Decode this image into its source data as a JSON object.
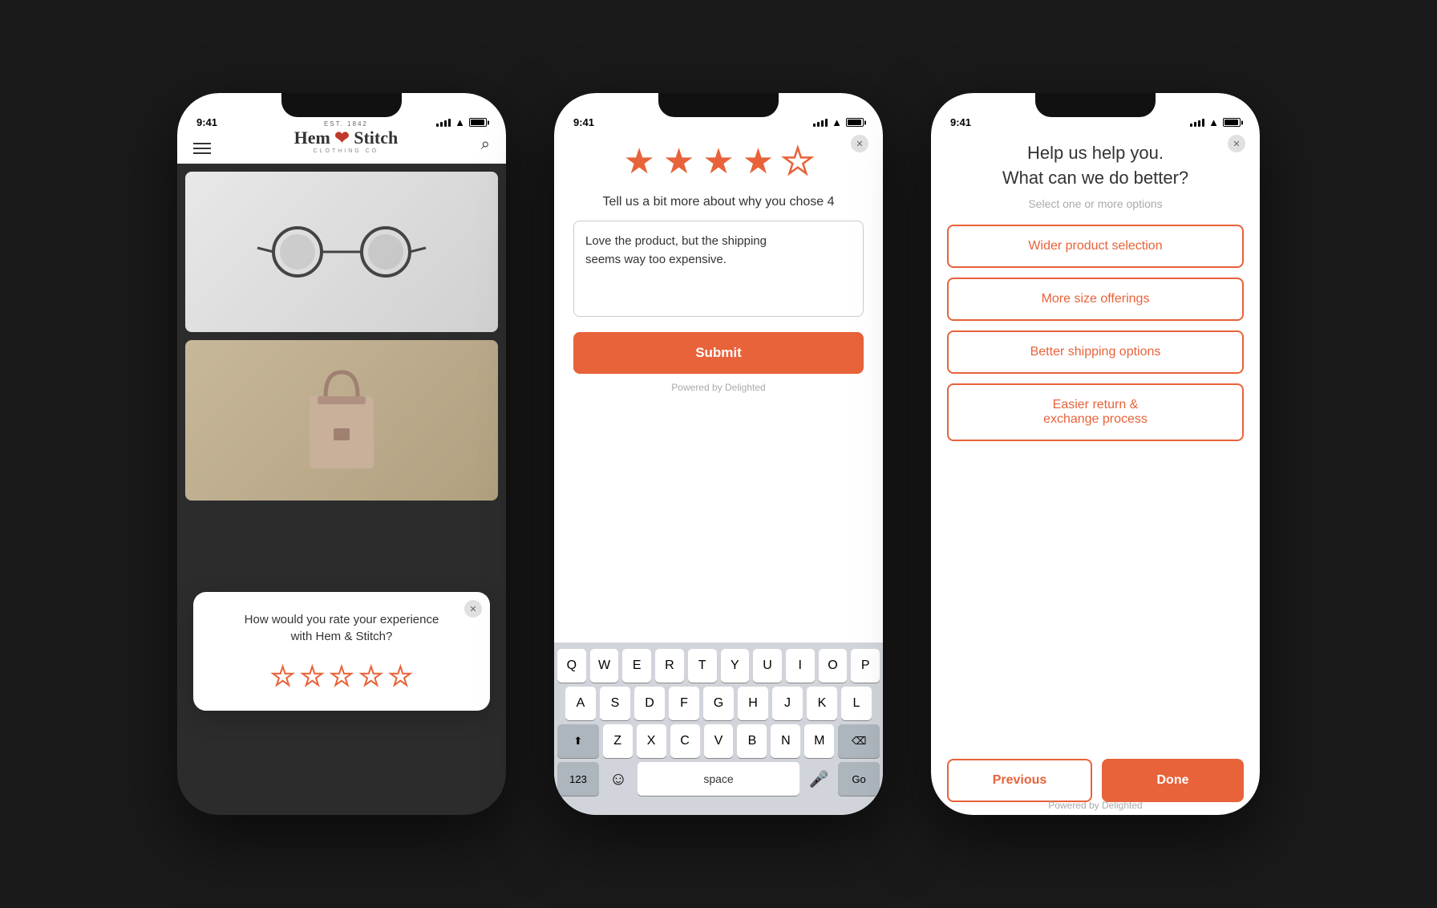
{
  "phone1": {
    "status_time": "9:41",
    "brand_est": "EST. 1842",
    "brand_name": "Hem",
    "brand_circle": "⊕",
    "brand_name2": "Stitch",
    "brand_sub": "CLOTHING CO",
    "modal": {
      "question_line1": "How would you rate your experience",
      "question_line2": "with Hem & Stitch?",
      "close_label": "✕",
      "stars": [
        0,
        0,
        0,
        0,
        0
      ]
    }
  },
  "phone2": {
    "status_time": "9:41",
    "close_label": "✕",
    "stars": [
      1,
      1,
      1,
      1,
      0
    ],
    "review_question": "Tell us a bit more about why you chose 4",
    "textarea_value": "Love the product, but the shipping\nseems way too expensive.",
    "submit_label": "Submit",
    "powered_label": "Powered by Delighted",
    "keyboard": {
      "row1": [
        "Q",
        "W",
        "E",
        "R",
        "T",
        "Y",
        "U",
        "I",
        "O",
        "P"
      ],
      "row2": [
        "A",
        "S",
        "D",
        "F",
        "G",
        "H",
        "J",
        "K",
        "L"
      ],
      "row3": [
        "Z",
        "X",
        "C",
        "V",
        "B",
        "N",
        "M"
      ],
      "num_label": "123",
      "space_label": "space",
      "go_label": "Go"
    }
  },
  "phone3": {
    "status_time": "9:41",
    "close_label": "✕",
    "title_line1": "Help us help you.",
    "title_line2": "What can we do better?",
    "subtitle": "Select one or more options",
    "options": [
      "Wider product selection",
      "More size offerings",
      "Better shipping options",
      "Easier return &\nexchange process"
    ],
    "prev_label": "Previous",
    "done_label": "Done",
    "powered_label": "Powered by Delighted"
  }
}
